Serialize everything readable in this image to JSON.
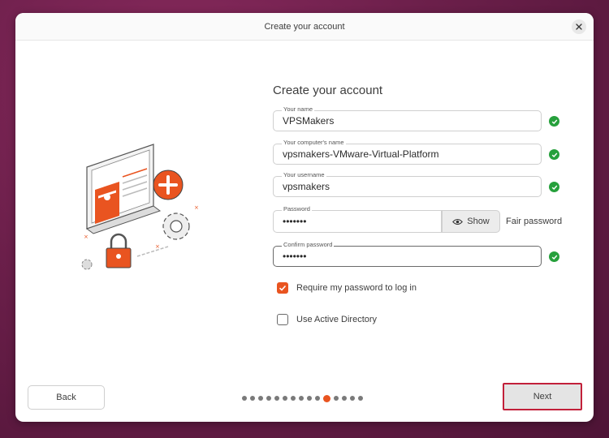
{
  "window": {
    "title": "Create your account"
  },
  "form": {
    "heading": "Create your account",
    "name": {
      "label": "Your name",
      "value": "VPSMakers",
      "valid": true
    },
    "computer_name": {
      "label": "Your computer's name",
      "value": "vpsmakers-VMware-Virtual-Platform",
      "valid": true
    },
    "username": {
      "label": "Your username",
      "value": "vpsmakers",
      "valid": true
    },
    "password": {
      "label": "Password",
      "value": "•••••••",
      "show_label": "Show",
      "strength": "Fair password"
    },
    "confirm_password": {
      "label": "Confirm password",
      "value": "•••••••",
      "valid": true
    }
  },
  "options": {
    "require_password": {
      "label": "Require my password to log in",
      "checked": true
    },
    "active_directory": {
      "label": "Use Active Directory",
      "checked": false
    }
  },
  "navigation": {
    "back_label": "Back",
    "next_label": "Next",
    "total_steps": 15,
    "current_step": 11
  },
  "colors": {
    "accent": "#e95420",
    "valid": "#26a03c",
    "highlight": "#c2203a"
  }
}
